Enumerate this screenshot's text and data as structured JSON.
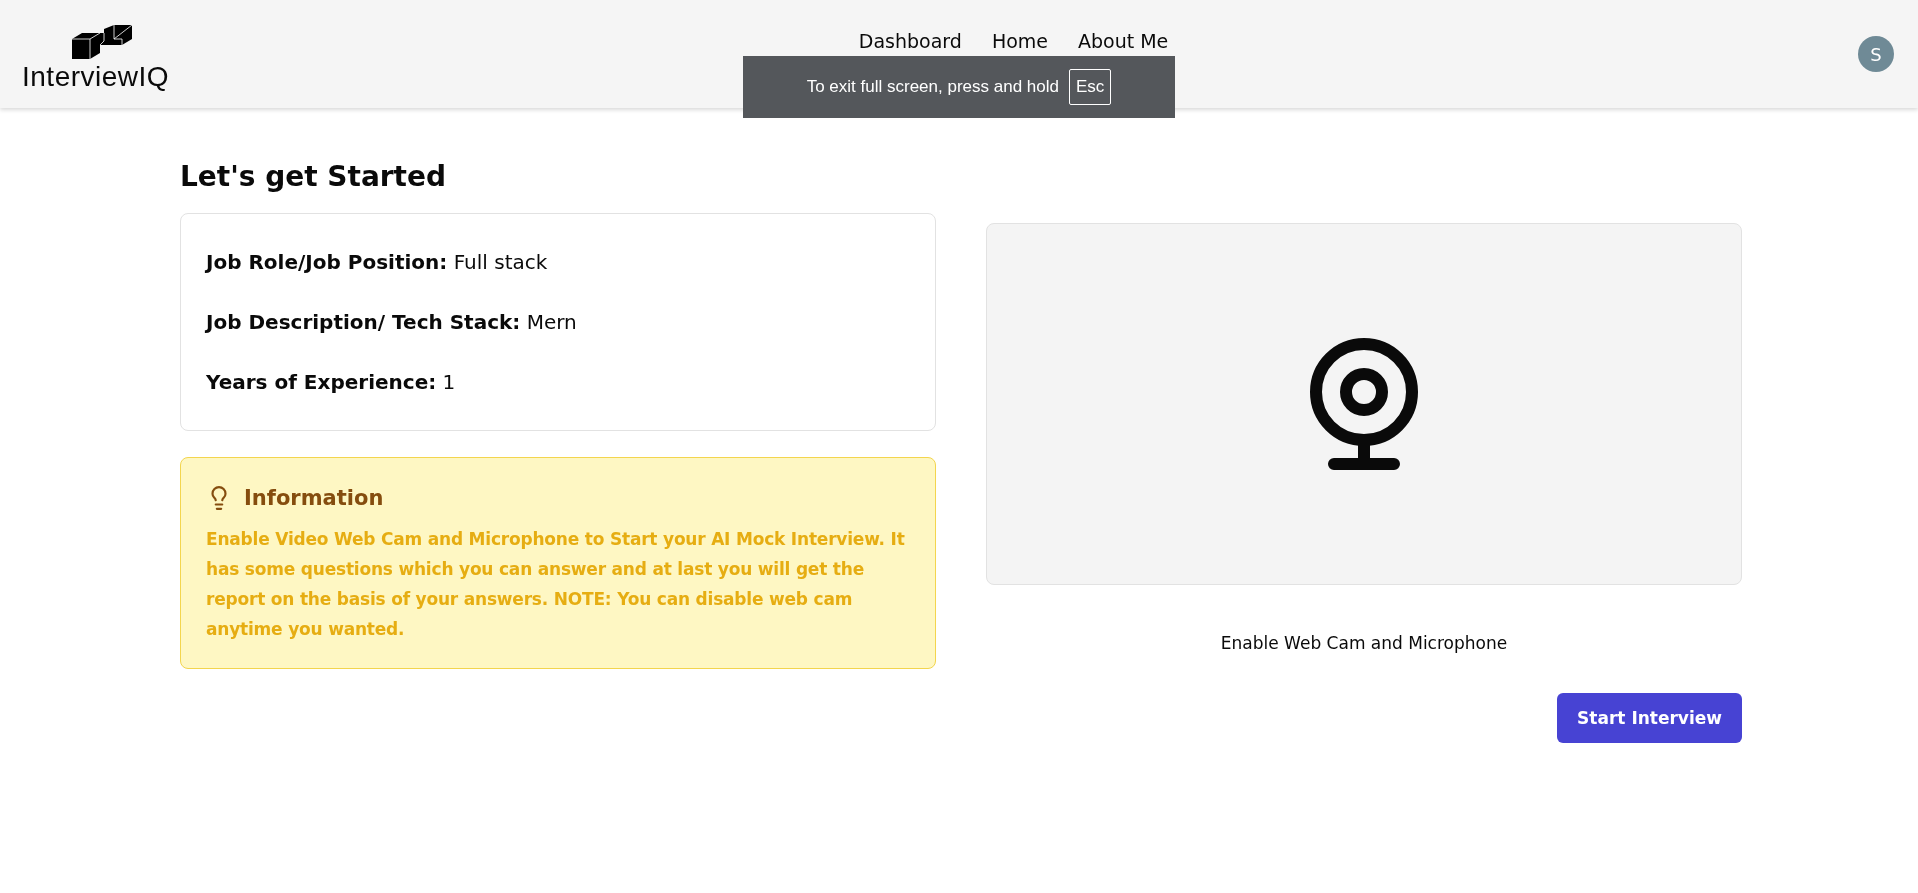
{
  "header": {
    "logo": "InterviewIQ",
    "nav": [
      {
        "label": "Dashboard"
      },
      {
        "label": "Home"
      },
      {
        "label": "About Me"
      }
    ],
    "avatar": "S"
  },
  "toast": {
    "text": "To exit full screen, press and hold",
    "key": "Esc"
  },
  "title": "Let's get Started",
  "details": [
    {
      "label": "Job Role/Job Position:",
      "value": "Full stack"
    },
    {
      "label": "Job Description/ Tech Stack:",
      "value": "Mern"
    },
    {
      "label": "Years of Experience:",
      "value": "1"
    }
  ],
  "info": {
    "title": "Information",
    "text": "Enable Video Web Cam and Microphone to Start your AI Mock Interview. It has some questions which you can answer and at last you will get the report on the basis of your answers. NOTE: You can disable web cam anytime you wanted."
  },
  "webcam": {
    "caption": "Enable Web Cam and Microphone"
  },
  "start_button": "Start Interview"
}
